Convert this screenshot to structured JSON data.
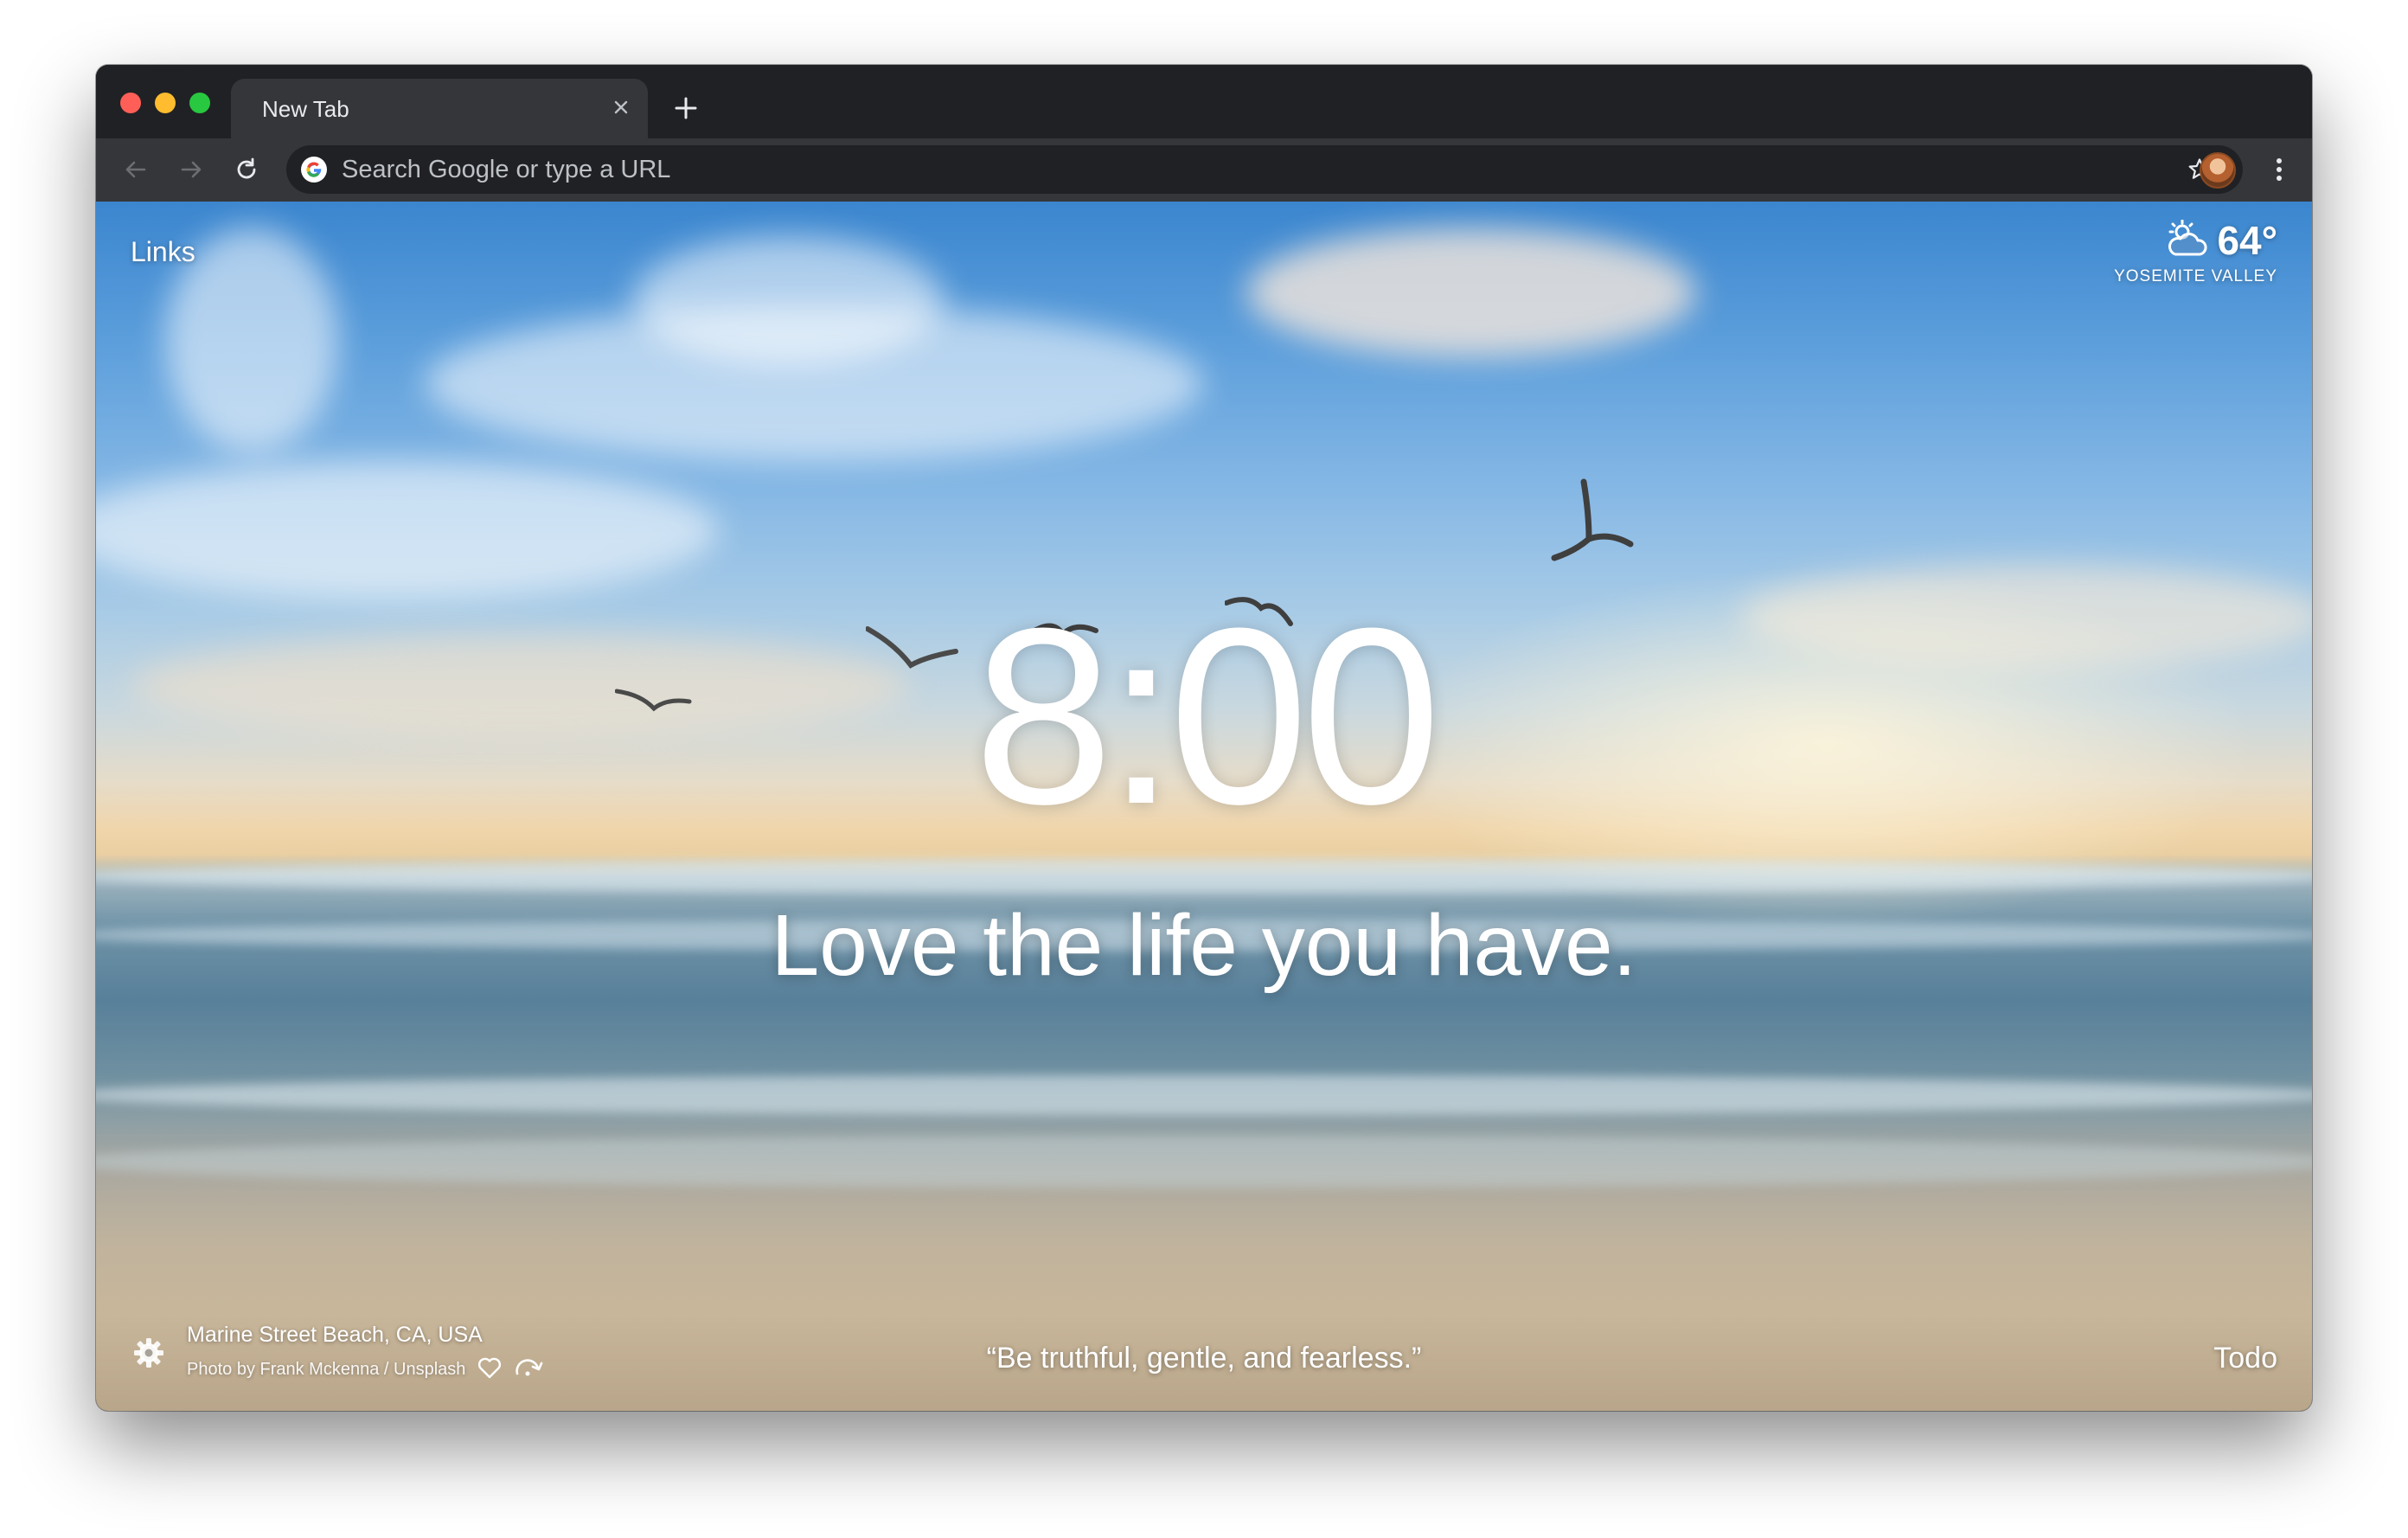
{
  "browser": {
    "tab": {
      "title": "New Tab"
    },
    "omnibox": {
      "placeholder": "Search Google or type a URL"
    },
    "icons": {
      "back": "back-arrow-icon",
      "forward": "forward-arrow-icon",
      "reload": "reload-icon",
      "bookmark": "star-icon",
      "menu": "kebab-menu-icon",
      "close_tab": "close-icon",
      "new_tab": "plus-icon"
    }
  },
  "dashboard": {
    "links_label": "Links",
    "weather": {
      "temperature": "64°",
      "location": "YOSEMITE VALLEY",
      "icon": "partly-cloudy-icon"
    },
    "clock": "8:00",
    "greeting": "Love the life you have.",
    "photo": {
      "location": "Marine Street Beach, CA, USA",
      "credit": "Photo by Frank Mckenna / Unsplash"
    },
    "quote": "“Be truthful, gentle, and fearless.”",
    "todo_label": "Todo"
  },
  "colors": {
    "chrome_dark": "#202124",
    "chrome_toolbar": "#35363a",
    "traffic_red": "#ff5f57",
    "traffic_yellow": "#febc2e",
    "traffic_green": "#28c840"
  }
}
